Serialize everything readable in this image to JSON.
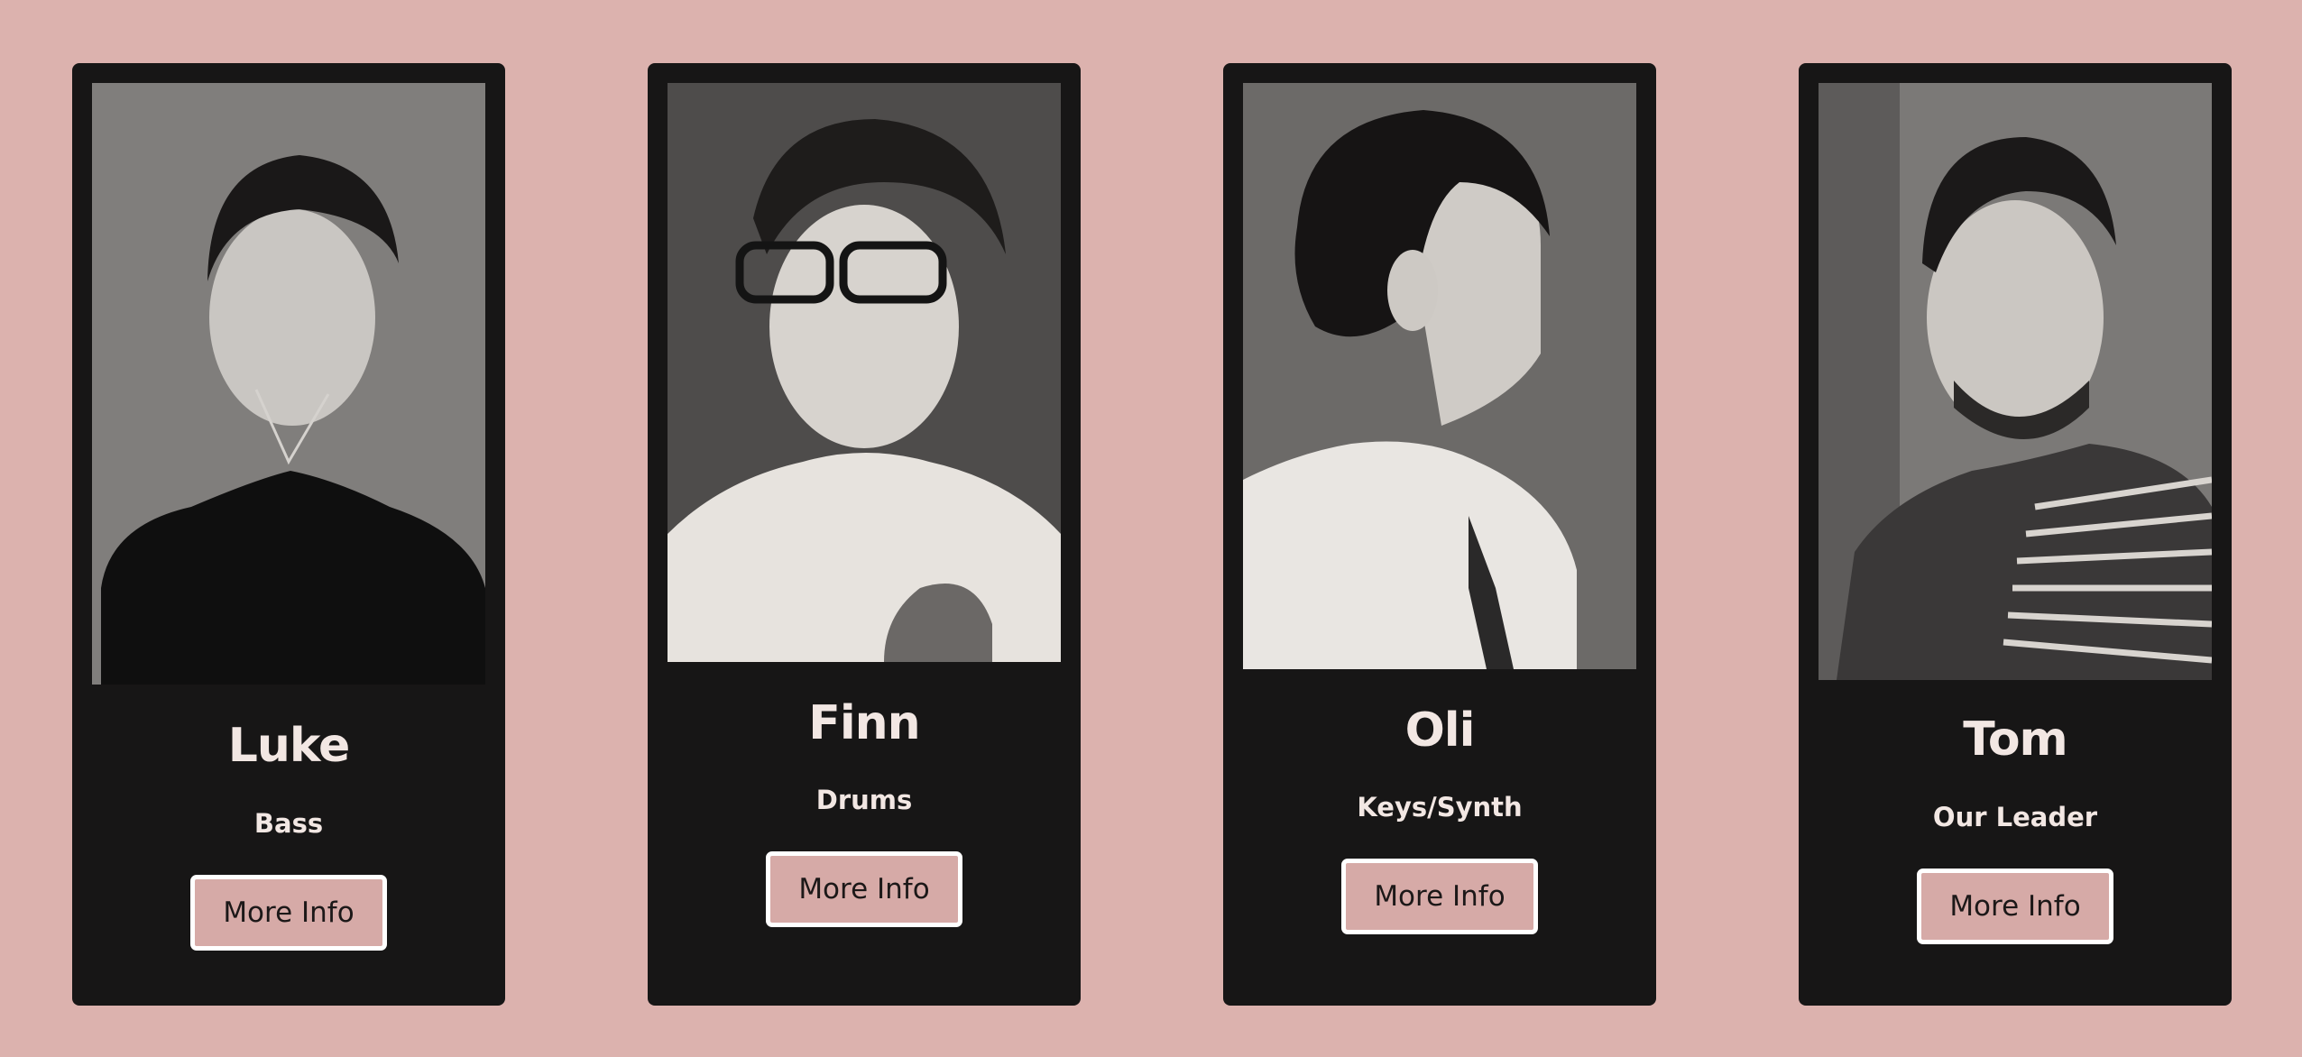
{
  "members": [
    {
      "name": "Luke",
      "role": "Bass",
      "button_label": "More Info",
      "photo_icon": "band-member-portrait"
    },
    {
      "name": "Finn",
      "role": "Drums",
      "button_label": "More Info",
      "photo_icon": "band-member-portrait"
    },
    {
      "name": "Oli",
      "role": "Keys/Synth",
      "button_label": "More Info",
      "photo_icon": "band-member-portrait"
    },
    {
      "name": "Tom",
      "role": "Our Leader",
      "button_label": "More Info",
      "photo_icon": "band-member-portrait"
    }
  ],
  "colors": {
    "page_background": "#dcb2ae",
    "card_background": "#171616",
    "button_background": "#d6aaa7",
    "button_border": "#ffffff",
    "card_text": "#f2e7e3"
  }
}
